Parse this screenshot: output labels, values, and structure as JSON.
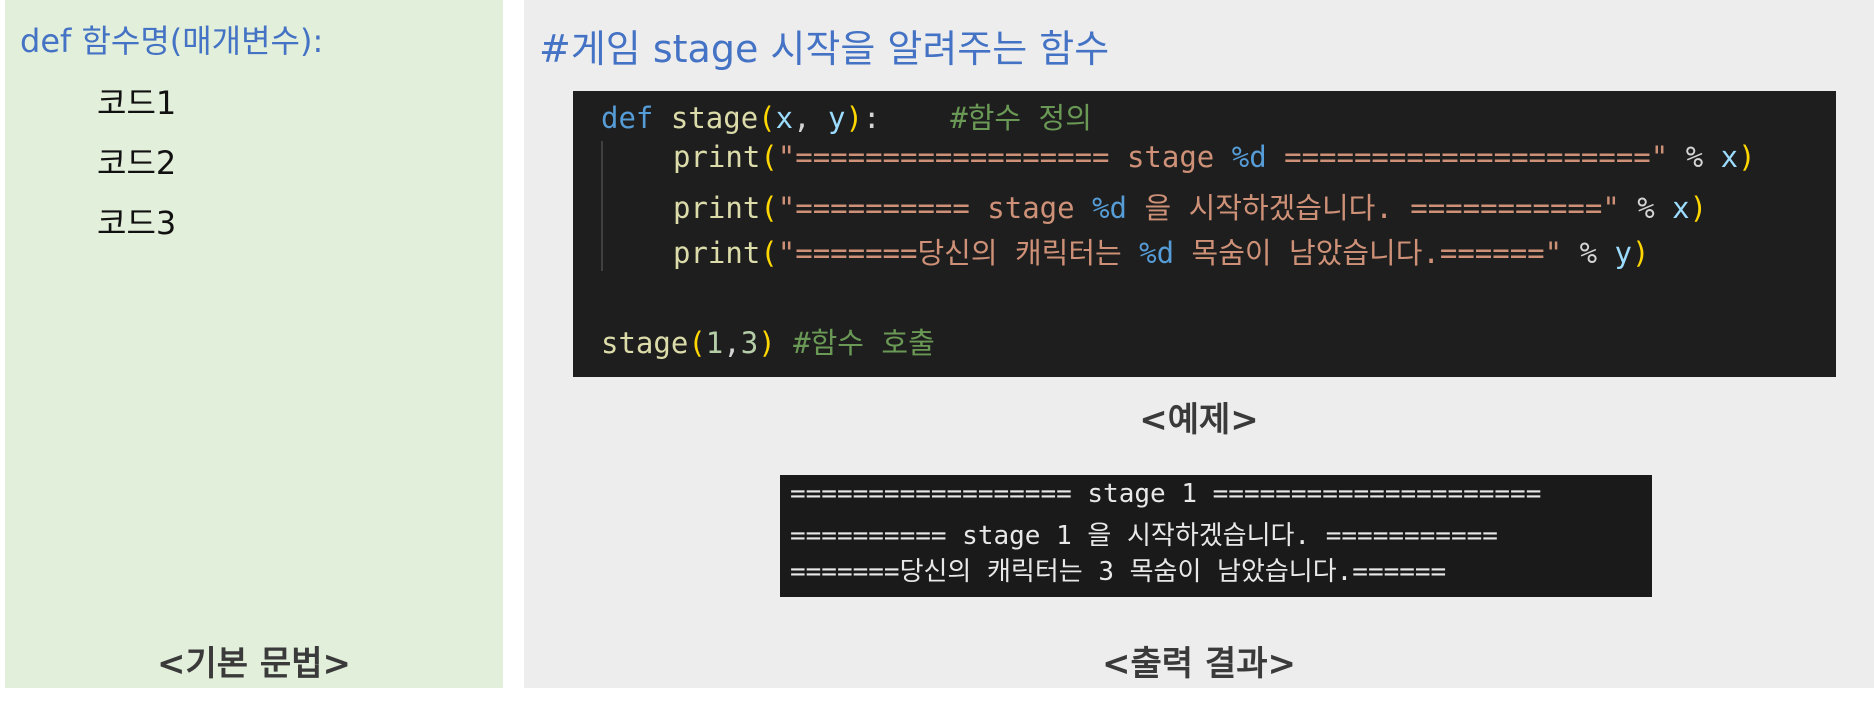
{
  "syntax_panel": {
    "header": "def 함수명(매개변수):",
    "lines": [
      "코드1",
      "코드2",
      "코드3"
    ],
    "caption": "<기본 문법>"
  },
  "example_panel": {
    "title": "#게임 stage 시작을 알려주는 함수",
    "code": {
      "line1": {
        "kw": "def",
        "fn": "stage",
        "p1": "(",
        "a1": "x",
        "comma": ", ",
        "a2": "y",
        "p2": ")",
        "colon": ":",
        "comment": "#함수 정의"
      },
      "line2": {
        "fn": "print",
        "p1": "(",
        "str1": "\"================== stage ",
        "fmt": "%d",
        "str2": " =====================\"",
        "op": " % ",
        "var": "x",
        "p2": ")"
      },
      "line3": {
        "fn": "print",
        "p1": "(",
        "str1": "\"========== stage ",
        "fmt": "%d",
        "str2": " 을 시작하겠습니다. ===========\"",
        "op": " % ",
        "var": "x",
        "p2": ")"
      },
      "line4": {
        "fn": "print",
        "p1": "(",
        "str1": "\"=======당신의 캐릭터는 ",
        "fmt": "%d",
        "str2": " 목숨이 남았습니다.======\"",
        "op": " % ",
        "var": "y",
        "p2": ")"
      },
      "line5": {
        "fn": "stage",
        "p1": "(",
        "n1": "1",
        "comma": ",",
        "n2": "3",
        "p2": ")",
        "comment": " #함수 호출"
      }
    },
    "example_caption": "<예제>",
    "output": [
      "================== stage 1 =====================",
      "========== stage 1 을 시작하겠습니다. ===========",
      "=======당신의 캐릭터는 3 목숨이 남았습니다.======"
    ],
    "output_caption": "<출력 결과>"
  }
}
